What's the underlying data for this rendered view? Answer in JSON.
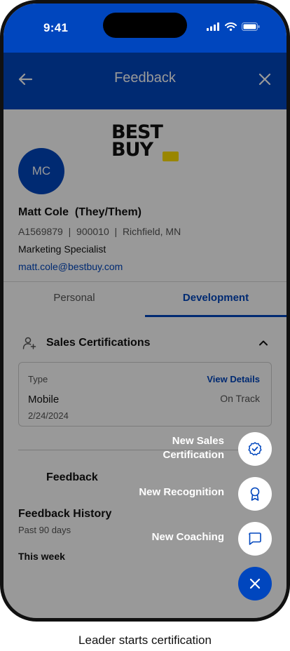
{
  "status_bar": {
    "time": "9:41"
  },
  "header": {
    "title": "Feedback",
    "back_icon": "arrow-left-icon",
    "close_icon": "close-icon"
  },
  "banner": {
    "logo_line1": "BEST",
    "logo_line2": "BUY",
    "logo_tag_color": "#ffe000"
  },
  "profile": {
    "initials": "MC",
    "name": "Matt Cole  (They/Them)",
    "meta": "A1569879  |  900010  |  Richfield, MN",
    "role": "Marketing Specialist",
    "email": "matt.cole@bestbuy.com"
  },
  "tabs": [
    {
      "label": "Personal",
      "active": false
    },
    {
      "label": "Development",
      "active": true
    }
  ],
  "sales_certifications": {
    "title": "Sales Certifications",
    "card": {
      "type_label": "Type",
      "view_details": "View Details",
      "category": "Mobile",
      "status": "On Track",
      "date": "2/24/2024"
    }
  },
  "feedback": {
    "label": "Feedback",
    "history_title": "Feedback History",
    "history_sub": "Past 90 days",
    "week_label": "This week"
  },
  "fab_menu": {
    "items": [
      {
        "label_line1": "New Sales",
        "label_line2": "Certification",
        "icon": "badge-check-icon"
      },
      {
        "label": "New Recognition",
        "icon": "ribbon-award-icon"
      },
      {
        "label": "New Coaching",
        "icon": "chat-bubble-icon"
      }
    ],
    "main_icon": "close-icon"
  },
  "caption": "Leader starts certification",
  "colors": {
    "brand_blue": "#0046be",
    "overlay": "rgba(0,0,0,0.40)"
  }
}
